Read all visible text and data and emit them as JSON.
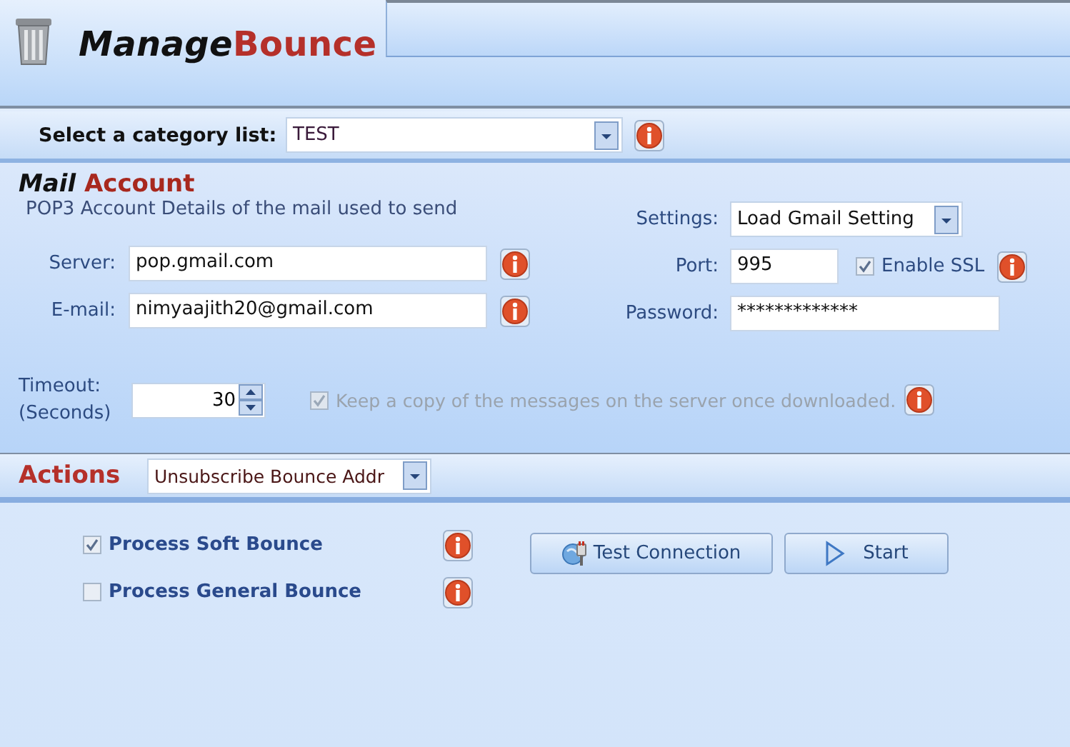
{
  "header": {
    "title_lead": "Manage",
    "title_rest": "Bounce"
  },
  "category": {
    "label": "Select a category list:",
    "value": "TEST"
  },
  "mail_account": {
    "heading_lead": "Mail",
    "heading_rest": "Account",
    "subtitle": "POP3 Account Details of the mail used to send",
    "fields": [
      {
        "label": "Server:",
        "value": "pop.gmail.com"
      },
      {
        "label": "E-mail:",
        "value": "nimyaajith20@gmail.com"
      }
    ],
    "settings": {
      "label": "Settings:",
      "value": "Load Gmail Setting"
    },
    "port": {
      "label": "Port:",
      "value": "995"
    },
    "ssl": {
      "label": "Enable SSL",
      "checked": true
    },
    "password": {
      "label": "Password:",
      "value": "*************"
    },
    "timeout": {
      "label": "Timeout:",
      "unit": "(Seconds)",
      "value": "30"
    },
    "keep_copy": {
      "label": "Keep a copy of the messages on the server once downloaded.",
      "checked": true,
      "disabled": true
    }
  },
  "actions": {
    "heading": "Actions",
    "value": "Unsubscribe Bounce Addr",
    "options": [
      {
        "label": "Process Soft Bounce",
        "checked": true
      },
      {
        "label": "Process General Bounce",
        "checked": false
      }
    ],
    "buttons": [
      {
        "label": "Test Connection",
        "kind": "test"
      },
      {
        "label": "Start",
        "kind": "start"
      }
    ]
  }
}
